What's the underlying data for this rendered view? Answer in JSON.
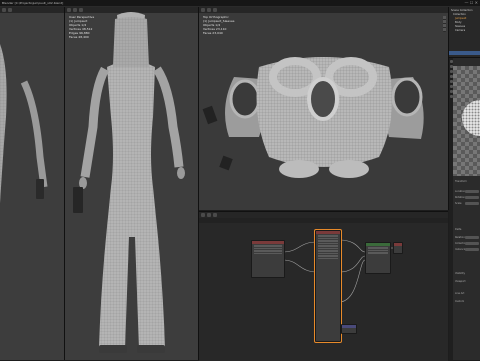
{
  "window": {
    "title": "Blender [C:\\Projects\\jumpsuit_v02.blend]",
    "controls": "—  ☐  ✕"
  },
  "viewport_left": {
    "info": [
      "User Perspective",
      "(1) Jumpsuit",
      "Objects 1/4",
      "Vertices 48,512",
      "Edges 96,880",
      "Faces 48,400"
    ]
  },
  "viewport_top": {
    "info": [
      "Top Orthographic",
      "(1) Jumpsuit_Sleeves",
      "Objects 1/4",
      "Vertices 23,110",
      "Faces 23,040"
    ]
  },
  "outliner": {
    "items": [
      "Scene Collection",
      "Collection",
      "Jumpsuit",
      "Body",
      "Sleeves",
      "Camera"
    ]
  },
  "properties": {
    "rows": [
      "Transform",
      "Location",
      "Rotation",
      "Scale",
      "Delta",
      "Relations",
      "Collections",
      "Instancing",
      "Visibility",
      "Viewport",
      "Line Art",
      "Custom"
    ]
  }
}
